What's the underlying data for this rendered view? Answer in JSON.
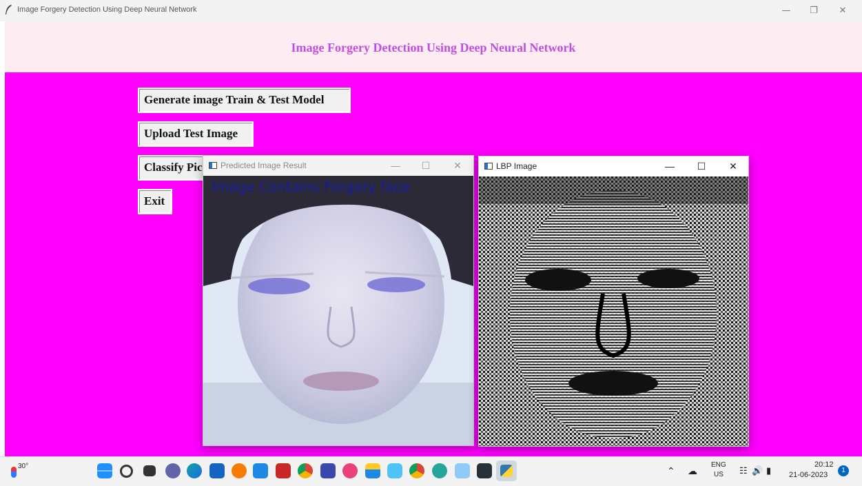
{
  "window": {
    "title": "Image Forgery Detection Using Deep Neural Network"
  },
  "app": {
    "heading": "Image Forgery Detection Using Deep Neural Network",
    "buttons": {
      "generate": "Generate image Train & Test Model",
      "upload": "Upload Test Image",
      "classify": "Classify Picture In Image",
      "exit": "Exit"
    }
  },
  "result_window": {
    "title": "Predicted Image Result",
    "overlay_text": "Image Contains Forgery face"
  },
  "lbp_window": {
    "title": "LBP Image"
  },
  "taskbar": {
    "weather": "30°",
    "lang_top": "ENG",
    "lang_bottom": "US",
    "time": "20:12",
    "date": "21-06-2023",
    "notification_count": "1",
    "icons": [
      "windows-start",
      "search",
      "task-view",
      "teams-chat",
      "edge",
      "store",
      "search-app",
      "calculator",
      "wps",
      "chrome",
      "app-blue",
      "app-pink",
      "file-explorer",
      "snipping-tool",
      "chrome-canary",
      "paint",
      "python-idle",
      "terminal",
      "python"
    ]
  },
  "colors": {
    "background": "#ff00ff",
    "header": "#fdecf1",
    "heading_text": "#c04ee0",
    "overlay_text": "#1a1aa0"
  }
}
